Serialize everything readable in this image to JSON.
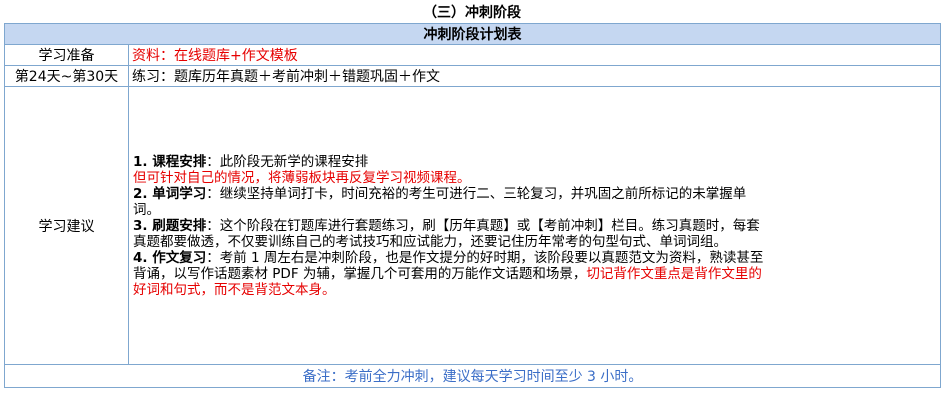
{
  "section_title": "（三）冲刺阶段",
  "table": {
    "caption": "冲刺阶段计划表",
    "prep": {
      "label": "学习准备",
      "value": "资料：在线题库+作文模板"
    },
    "days": {
      "label": "第24天~第30天",
      "value": "练习：题库历年真题＋考前冲刺＋错题巩固＋作文"
    },
    "advice": {
      "label": "学习建议",
      "item1_title": "1. 课程安排",
      "item1_text": "：此阶段无新学的课程安排",
      "item1_red": "但可针对自己的情况，将薄弱板块再反复学习视频课程。",
      "item2_title": "2. 单词学习",
      "item2_text": "：继续坚持单词打卡，时间充裕的考生可进行二、三轮复习，并巩固之前所标记的未掌握单词。",
      "item3_title": "3. 刷题安排",
      "item3_text": "：这个阶段在钉题库进行套题练习，刷【历年真题】或【考前冲刺】栏目。练习真题时，每套真题都要做透，不仅要训练自己的考试技巧和应试能力，还要记住历年常考的句型句式、单词词组。",
      "item4_title": "4. 作文复习",
      "item4_text": "：考前 1 周左右是冲刺阶段，也是作文提分的好时期，该阶段要以真题范文为资料，熟读甚至背诵，以写作话题素材 PDF 为辅，掌握几个可套用的万能作文话题和场景，",
      "item4_red": "切记背作文重点是背作文里的好词和句式，而不是背范文本身。"
    },
    "note": "备注：考前全力冲刺，建议每天学习时间至少 3 小时。"
  }
}
